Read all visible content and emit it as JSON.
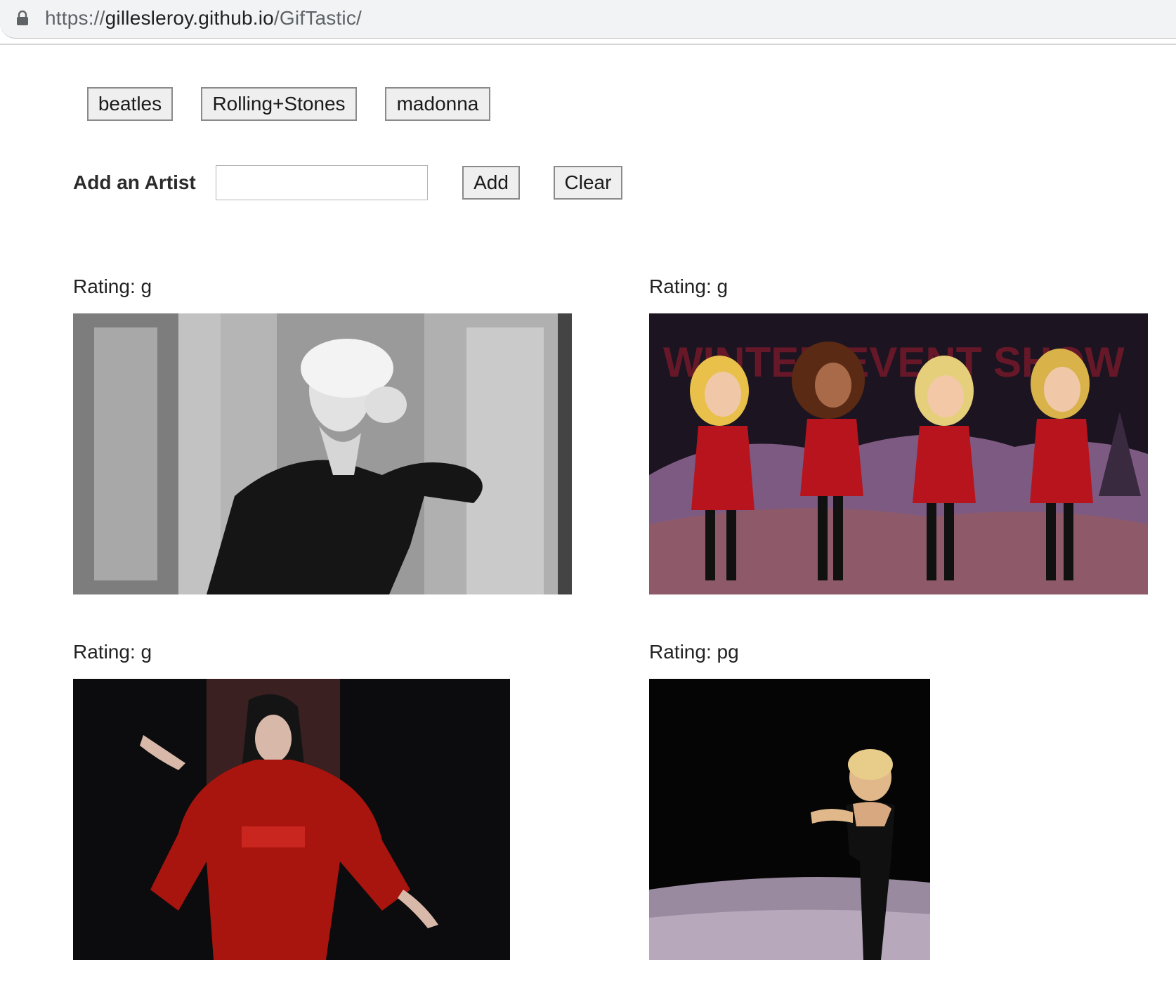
{
  "browser": {
    "url_scheme": "https://",
    "url_host": "gillesleroy.github.io",
    "url_path": "/GifTastic/"
  },
  "topics": [
    {
      "label": "beatles"
    },
    {
      "label": "Rolling+Stones"
    },
    {
      "label": "madonna"
    }
  ],
  "add_artist": {
    "label": "Add an Artist",
    "input_value": "",
    "add_label": "Add",
    "clear_label": "Clear"
  },
  "gifs": [
    {
      "rating": "Rating: g",
      "description": "black and white GIF of a blonde woman in black dress holding her head"
    },
    {
      "rating": "Rating: g",
      "description": "animated GIF of four caricature singers in red santa dresses dancing in snow"
    },
    {
      "rating": "Rating: g",
      "description": "GIF of a dark-haired woman in a red robe spreading her arms"
    },
    {
      "rating": "Rating: pg",
      "description": "GIF of a blonde woman in black outfit dancing on a dark stage"
    }
  ],
  "colors": {
    "button_bg": "#efefef",
    "button_border": "#8a8a8a",
    "urlbar_bg": "#f1f3f4"
  },
  "icons": {
    "lock": "lock-icon"
  }
}
